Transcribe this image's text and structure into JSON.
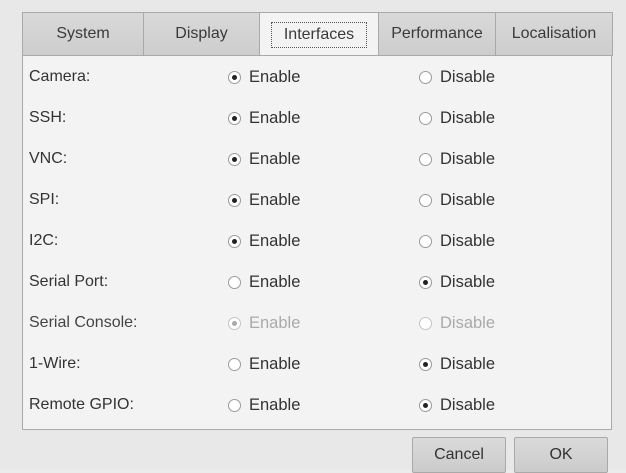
{
  "tabs": [
    {
      "label": "System",
      "active": false
    },
    {
      "label": "Display",
      "active": false
    },
    {
      "label": "Interfaces",
      "active": true
    },
    {
      "label": "Performance",
      "active": false
    },
    {
      "label": "Localisation",
      "active": false
    }
  ],
  "options": {
    "enable_label": "Enable",
    "disable_label": "Disable"
  },
  "interfaces": [
    {
      "name": "Camera:",
      "selected": "enable",
      "disabled": false
    },
    {
      "name": "SSH:",
      "selected": "enable",
      "disabled": false
    },
    {
      "name": "VNC:",
      "selected": "enable",
      "disabled": false
    },
    {
      "name": "SPI:",
      "selected": "enable",
      "disabled": false
    },
    {
      "name": "I2C:",
      "selected": "enable",
      "disabled": false
    },
    {
      "name": "Serial Port:",
      "selected": "disable",
      "disabled": false
    },
    {
      "name": "Serial Console:",
      "selected": "enable",
      "disabled": true
    },
    {
      "name": "1-Wire:",
      "selected": "disable",
      "disabled": false
    },
    {
      "name": "Remote GPIO:",
      "selected": "disable",
      "disabled": false
    }
  ],
  "buttons": {
    "cancel_label": "Cancel",
    "ok_label": "OK"
  }
}
